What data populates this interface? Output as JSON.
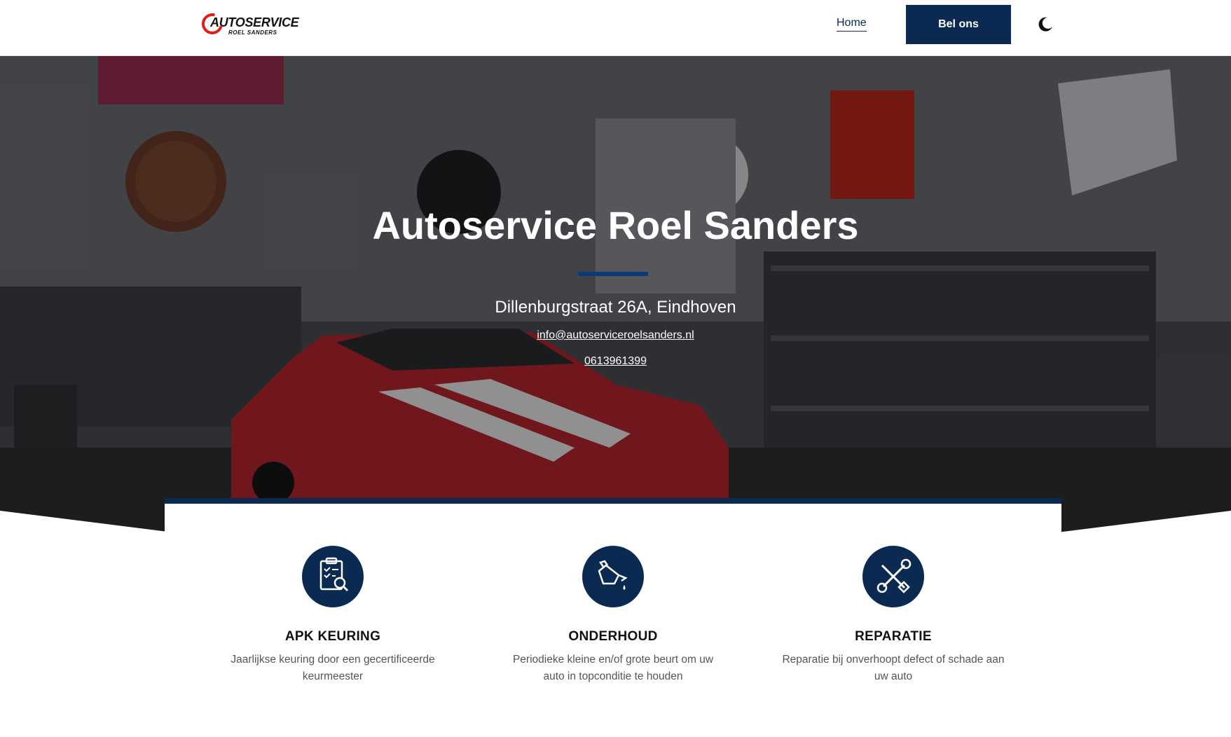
{
  "header": {
    "logo_main": "AUTOSERVICE",
    "logo_sub": "ROEL SANDERS",
    "nav_home": "Home",
    "call_button": "Bel ons",
    "theme_icon": "moon-icon"
  },
  "hero": {
    "title": "Autoservice Roel Sanders",
    "address": "Dillenburgstraat 26A, Eindhoven",
    "email": "info@autoserviceroelsanders.nl",
    "phone": "0613961399",
    "background": "garage-photo"
  },
  "services": [
    {
      "icon": "clipboard-checklist-icon",
      "title": "APK KEURING",
      "description": "Jaarlijkse keuring door een gecertificeerde keurmeester"
    },
    {
      "icon": "oil-can-icon",
      "title": "ONDERHOUD",
      "description": "Periodieke kleine en/of grote beurt om uw auto in topconditie te houden"
    },
    {
      "icon": "wrench-screwdriver-icon",
      "title": "REPARATIE",
      "description": "Reparatie bij onverhoopt defect of schade aan uw auto"
    }
  ],
  "colors": {
    "brand_navy": "#0a2a52",
    "hero_accent": "#0a3a78",
    "logo_red": "#e21b1b"
  }
}
